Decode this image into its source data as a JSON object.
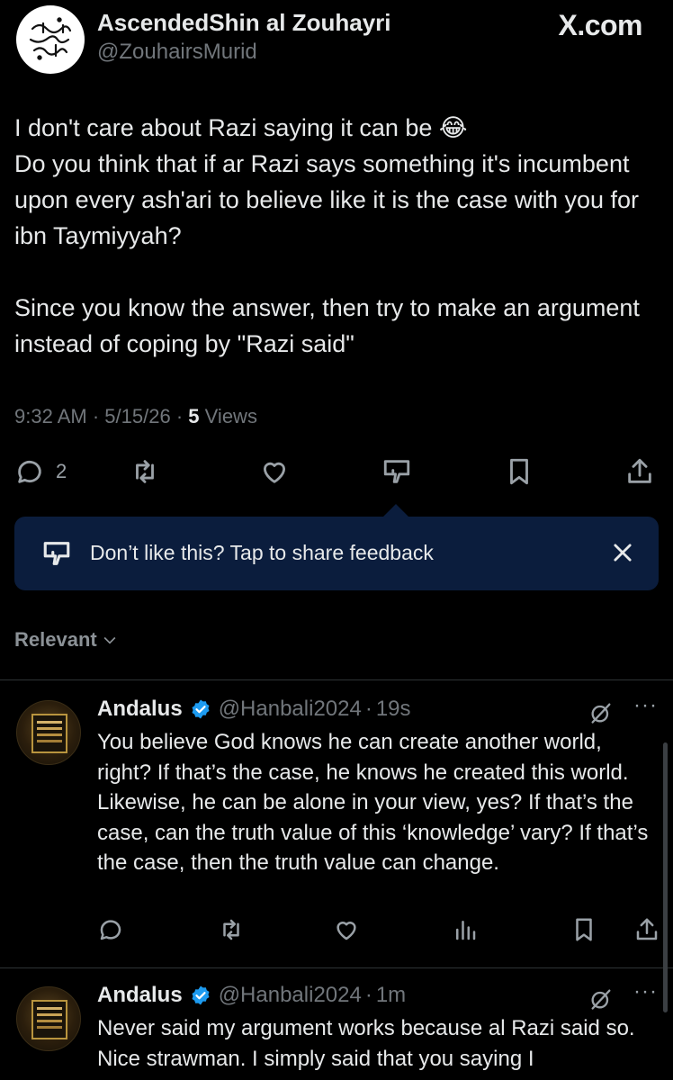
{
  "header": {
    "display_name": "AscendedShin al Zouhayri",
    "handle": "@ZouhairsMurid",
    "site": "X.com"
  },
  "tweet": {
    "paragraph_1": "I don't care about Razi saying it can be 😂\nDo you think that if ar Razi says something it's incumbent upon every ash'ari to believe like it is the case with you for ibn Taymiyyah?",
    "paragraph_2": "Since you know the answer, then try to make an argument instead of coping by \"Razi said\"",
    "time": "9:32 AM",
    "date": "5/15/26",
    "separator": "·",
    "views_count": "5",
    "views_label": "Views"
  },
  "actions": {
    "reply_count": "2",
    "icons": [
      "reply-icon",
      "retweet-icon",
      "like-icon",
      "dislike-icon",
      "bookmark-icon",
      "share-icon"
    ]
  },
  "feedback_tooltip": {
    "text": "Don’t like this? Tap to share feedback",
    "background": "#0b1d3d"
  },
  "sort": {
    "label": "Relevant"
  },
  "replies": [
    {
      "name": "Andalus",
      "handle": "@Hanbali2024",
      "time": "19s",
      "text": "You believe God knows he can create another world, right? If that’s the case, he knows he created this world. Likewise, he can be alone in your view, yes? If that’s the case, can the truth value of this ‘knowledge’ vary? If that’s the case, then the truth value can change."
    },
    {
      "name": "Andalus",
      "handle": "@Hanbali2024",
      "time": "1m",
      "text": "Never said my argument works because al Razi said so. Nice strawman. I simply said that you saying I"
    }
  ],
  "colors": {
    "background": "#000000",
    "text": "#e7e9ea",
    "muted": "#71767b",
    "verified": "#1d9bf0"
  }
}
